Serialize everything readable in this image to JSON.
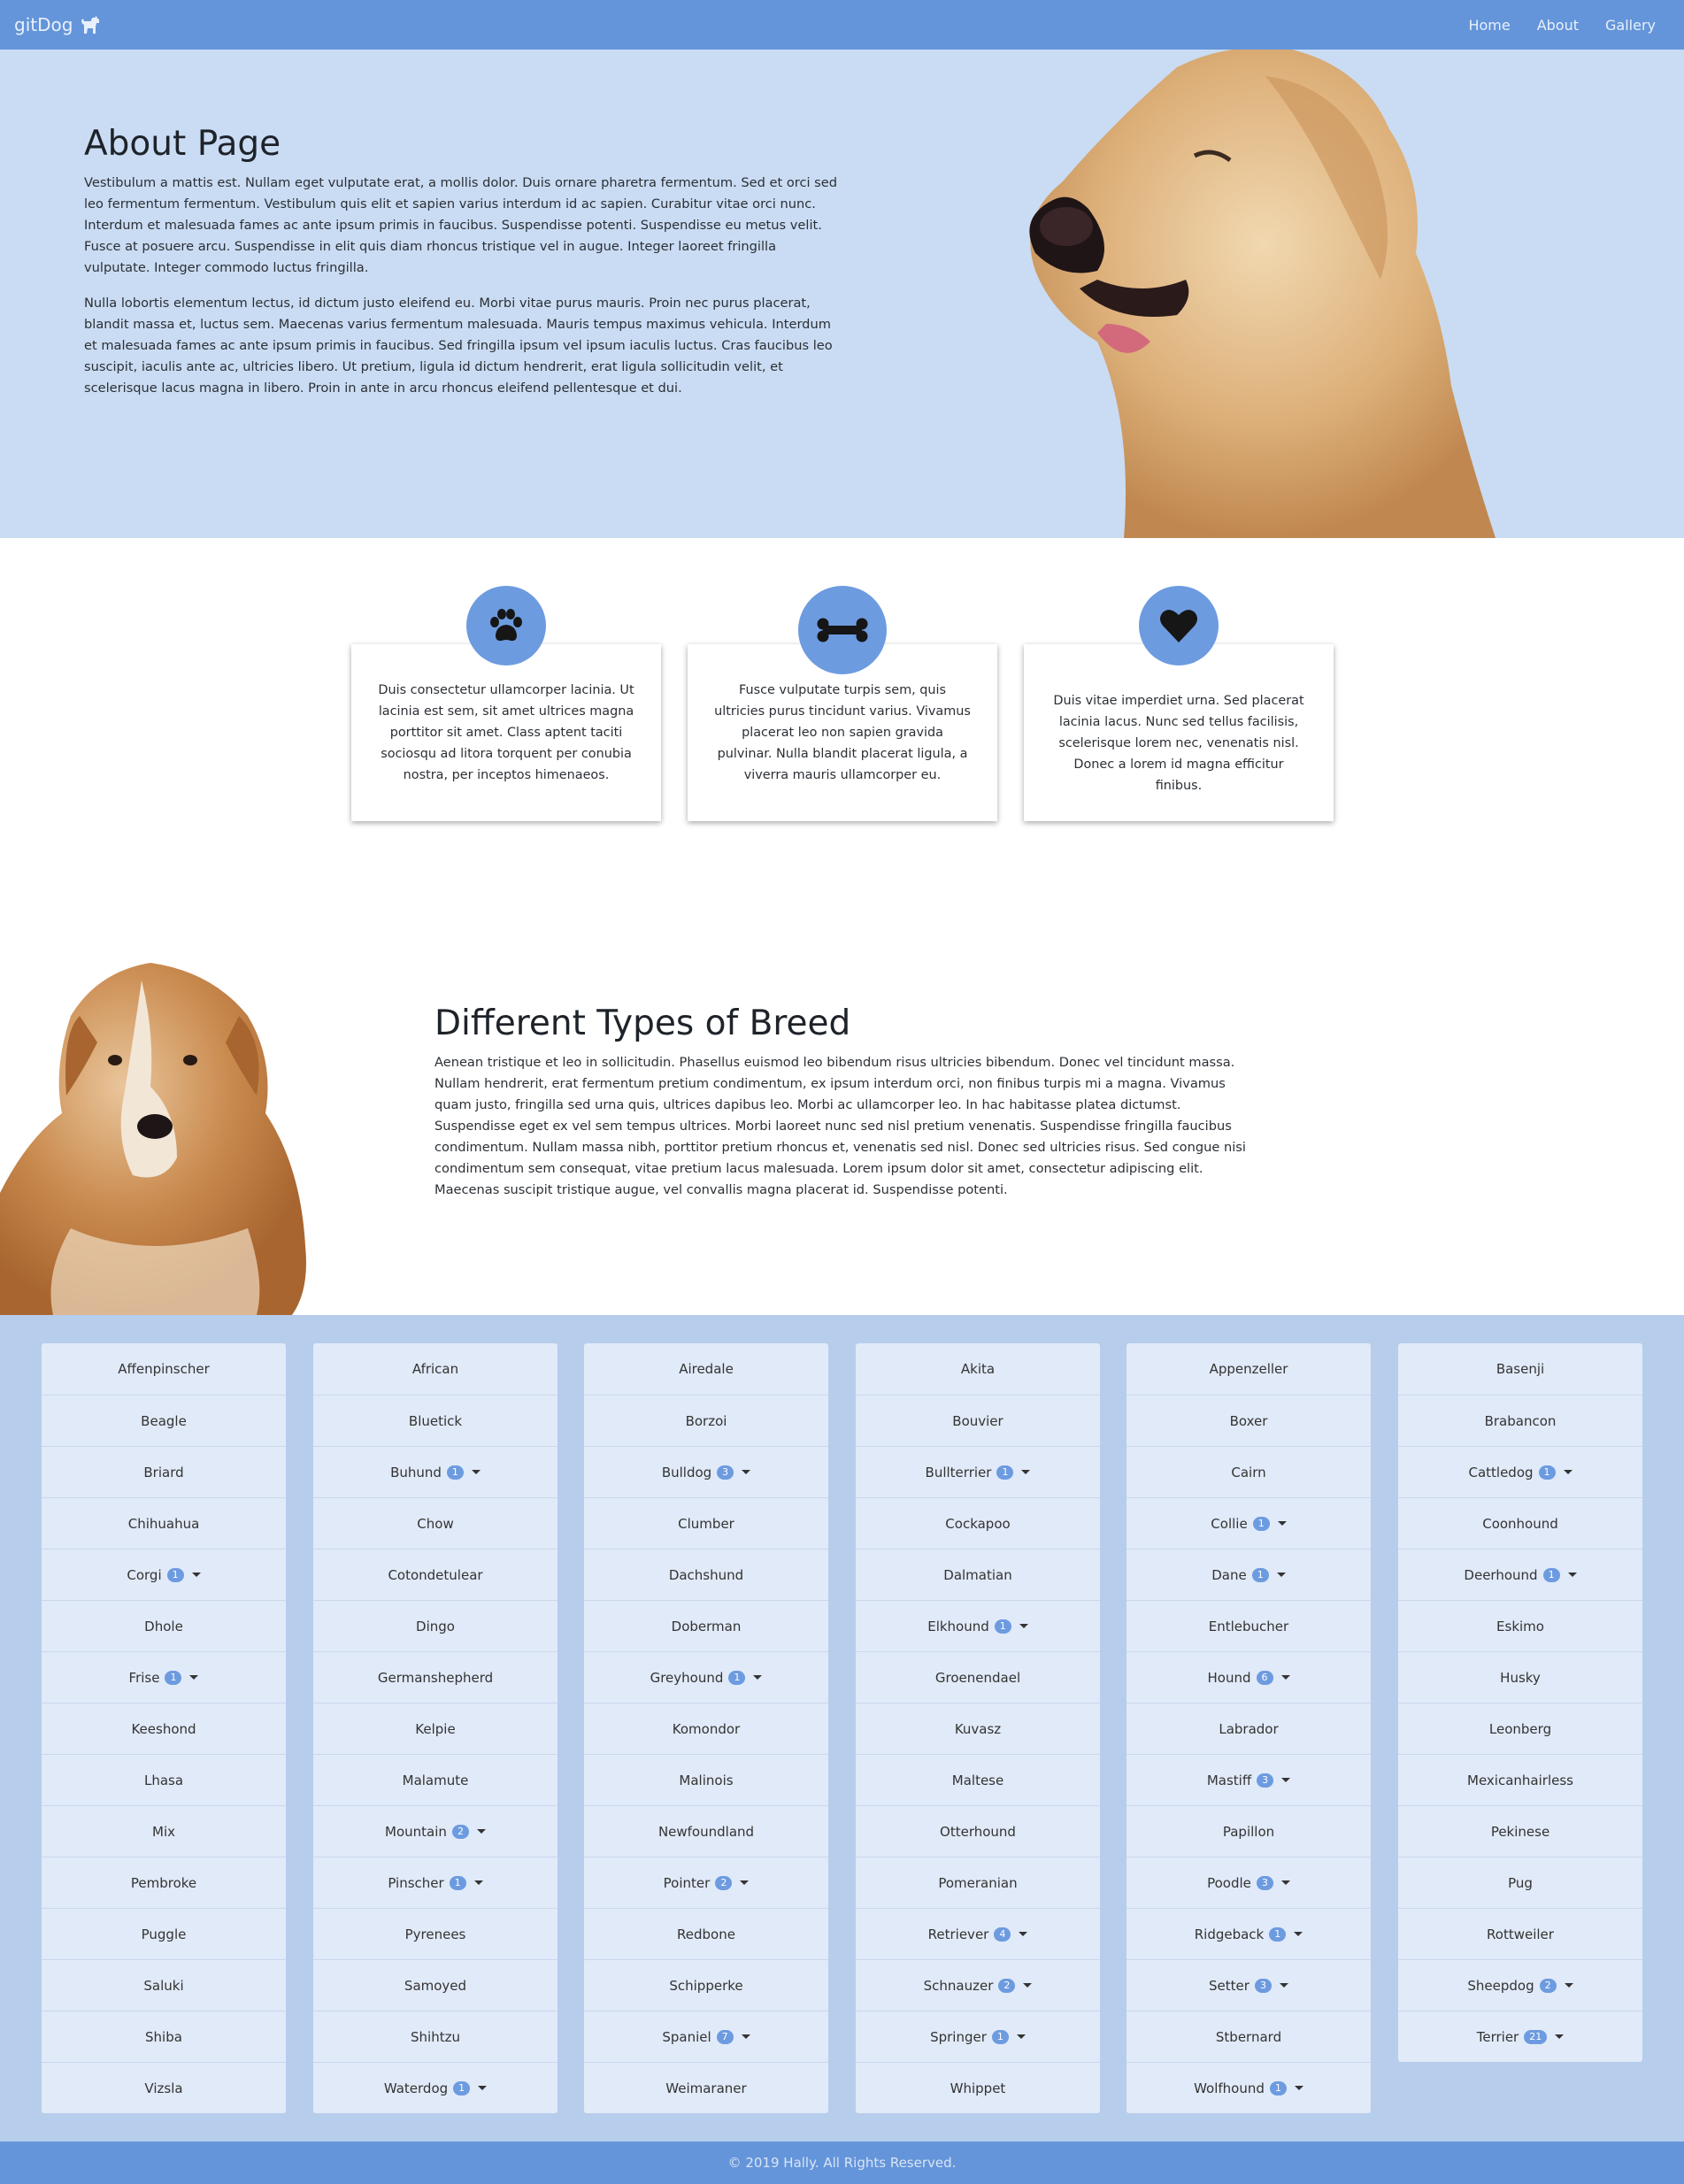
{
  "nav": {
    "brand": "gitDog",
    "links": [
      "Home",
      "About",
      "Gallery"
    ]
  },
  "hero": {
    "title": "About Page",
    "paragraphs": [
      "Vestibulum a mattis est. Nullam eget vulputate erat, a mollis dolor. Duis ornare pharetra fermentum. Sed et orci sed leo fermentum fermentum. Vestibulum quis elit et sapien varius interdum id ac sapien. Curabitur vitae orci nunc. Interdum et malesuada fames ac ante ipsum primis in faucibus. Suspendisse potenti. Suspendisse eu metus velit. Fusce at posuere arcu. Suspendisse in elit quis diam rhoncus tristique vel in augue. Integer laoreet fringilla vulputate. Integer commodo luctus fringilla.",
      "Nulla lobortis elementum lectus, id dictum justo eleifend eu. Morbi vitae purus mauris. Proin nec purus placerat, blandit massa et, luctus sem. Maecenas varius fermentum malesuada. Mauris tempus maximus vehicula. Interdum et malesuada fames ac ante ipsum primis in faucibus. Sed fringilla ipsum vel ipsum iaculis luctus. Cras faucibus leo suscipit, iaculis ante ac, ultricies libero. Ut pretium, ligula id dictum hendrerit, erat ligula sollicitudin velit, et scelerisque lacus magna in libero. Proin in ante in arcu rhoncus eleifend pellentesque et dui."
    ]
  },
  "features": [
    {
      "icon": "paw-icon",
      "text": "Duis consectetur ullamcorper lacinia. Ut lacinia est sem, sit amet ultrices magna porttitor sit amet. Class aptent taciti sociosqu ad litora torquent per conubia nostra, per inceptos himenaeos."
    },
    {
      "icon": "bone-icon",
      "text": "Fusce vulputate turpis sem, quis ultricies purus tincidunt varius. Vivamus placerat leo non sapien gravida pulvinar. Nulla blandit placerat ligula, a viverra mauris ullamcorper eu."
    },
    {
      "icon": "heart-icon",
      "text": "Duis vitae imperdiet urna. Sed placerat lacinia lacus. Nunc sed tellus facilisis, scelerisque lorem nec, venenatis nisl. Donec a lorem id magna efficitur finibus."
    }
  ],
  "breeds_intro": {
    "title": "Different Types of Breed",
    "text": "Aenean tristique et leo in sollicitudin. Phasellus euismod leo bibendum risus ultricies bibendum. Donec vel tincidunt massa. Nullam hendrerit, erat fermentum pretium condimentum, ex ipsum interdum orci, non finibus turpis mi a magna. Vivamus quam justo, fringilla sed urna quis, ultrices dapibus leo. Morbi ac ullamcorper leo. In hac habitasse platea dictumst. Suspendisse eget ex vel sem tempus ultrices. Morbi laoreet nunc sed nisl pretium venenatis. Suspendisse fringilla faucibus condimentum. Nullam massa nibh, porttitor pretium rhoncus et, venenatis sed nisl. Donec sed ultricies risus. Sed congue nisi condimentum sem consequat, vitae pretium lacus malesuada. Lorem ipsum dolor sit amet, consectetur adipiscing elit. Maecenas suscipit tristique augue, vel convallis magna placerat id. Suspendisse potenti."
  },
  "breed_columns": [
    [
      {
        "name": "Affenpinscher"
      },
      {
        "name": "Beagle"
      },
      {
        "name": "Briard"
      },
      {
        "name": "Chihuahua"
      },
      {
        "name": "Corgi",
        "count": "1"
      },
      {
        "name": "Dhole"
      },
      {
        "name": "Frise",
        "count": "1"
      },
      {
        "name": "Keeshond"
      },
      {
        "name": "Lhasa"
      },
      {
        "name": "Mix"
      },
      {
        "name": "Pembroke"
      },
      {
        "name": "Puggle"
      },
      {
        "name": "Saluki"
      },
      {
        "name": "Shiba"
      },
      {
        "name": "Vizsla"
      }
    ],
    [
      {
        "name": "African"
      },
      {
        "name": "Bluetick"
      },
      {
        "name": "Buhund",
        "count": "1"
      },
      {
        "name": "Chow"
      },
      {
        "name": "Cotondetulear"
      },
      {
        "name": "Dingo"
      },
      {
        "name": "Germanshepherd"
      },
      {
        "name": "Kelpie"
      },
      {
        "name": "Malamute"
      },
      {
        "name": "Mountain",
        "count": "2"
      },
      {
        "name": "Pinscher",
        "count": "1"
      },
      {
        "name": "Pyrenees"
      },
      {
        "name": "Samoyed"
      },
      {
        "name": "Shihtzu"
      },
      {
        "name": "Waterdog",
        "count": "1"
      }
    ],
    [
      {
        "name": "Airedale"
      },
      {
        "name": "Borzoi"
      },
      {
        "name": "Bulldog",
        "count": "3"
      },
      {
        "name": "Clumber"
      },
      {
        "name": "Dachshund"
      },
      {
        "name": "Doberman"
      },
      {
        "name": "Greyhound",
        "count": "1"
      },
      {
        "name": "Komondor"
      },
      {
        "name": "Malinois"
      },
      {
        "name": "Newfoundland"
      },
      {
        "name": "Pointer",
        "count": "2"
      },
      {
        "name": "Redbone"
      },
      {
        "name": "Schipperke"
      },
      {
        "name": "Spaniel",
        "count": "7"
      },
      {
        "name": "Weimaraner"
      }
    ],
    [
      {
        "name": "Akita"
      },
      {
        "name": "Bouvier"
      },
      {
        "name": "Bullterrier",
        "count": "1"
      },
      {
        "name": "Cockapoo"
      },
      {
        "name": "Dalmatian"
      },
      {
        "name": "Elkhound",
        "count": "1"
      },
      {
        "name": "Groenendael"
      },
      {
        "name": "Kuvasz"
      },
      {
        "name": "Maltese"
      },
      {
        "name": "Otterhound"
      },
      {
        "name": "Pomeranian"
      },
      {
        "name": "Retriever",
        "count": "4"
      },
      {
        "name": "Schnauzer",
        "count": "2"
      },
      {
        "name": "Springer",
        "count": "1"
      },
      {
        "name": "Whippet"
      }
    ],
    [
      {
        "name": "Appenzeller"
      },
      {
        "name": "Boxer"
      },
      {
        "name": "Cairn"
      },
      {
        "name": "Collie",
        "count": "1"
      },
      {
        "name": "Dane",
        "count": "1"
      },
      {
        "name": "Entlebucher"
      },
      {
        "name": "Hound",
        "count": "6"
      },
      {
        "name": "Labrador"
      },
      {
        "name": "Mastiff",
        "count": "3"
      },
      {
        "name": "Papillon"
      },
      {
        "name": "Poodle",
        "count": "3"
      },
      {
        "name": "Ridgeback",
        "count": "1"
      },
      {
        "name": "Setter",
        "count": "3"
      },
      {
        "name": "Stbernard"
      },
      {
        "name": "Wolfhound",
        "count": "1"
      }
    ],
    [
      {
        "name": "Basenji"
      },
      {
        "name": "Brabancon"
      },
      {
        "name": "Cattledog",
        "count": "1"
      },
      {
        "name": "Coonhound"
      },
      {
        "name": "Deerhound",
        "count": "1"
      },
      {
        "name": "Eskimo"
      },
      {
        "name": "Husky"
      },
      {
        "name": "Leonberg"
      },
      {
        "name": "Mexicanhairless"
      },
      {
        "name": "Pekinese"
      },
      {
        "name": "Pug"
      },
      {
        "name": "Rottweiler"
      },
      {
        "name": "Sheepdog",
        "count": "2"
      },
      {
        "name": "Terrier",
        "count": "21"
      }
    ]
  ],
  "footer": {
    "text": "© 2019 Hally. All Rights Reserved."
  },
  "colors": {
    "navbar": "#6495da",
    "hero_bg": "#cadcf3",
    "grid_bg": "#b7cdec",
    "card_bg": "#e1eaf8",
    "accent": "#6d9be0"
  }
}
